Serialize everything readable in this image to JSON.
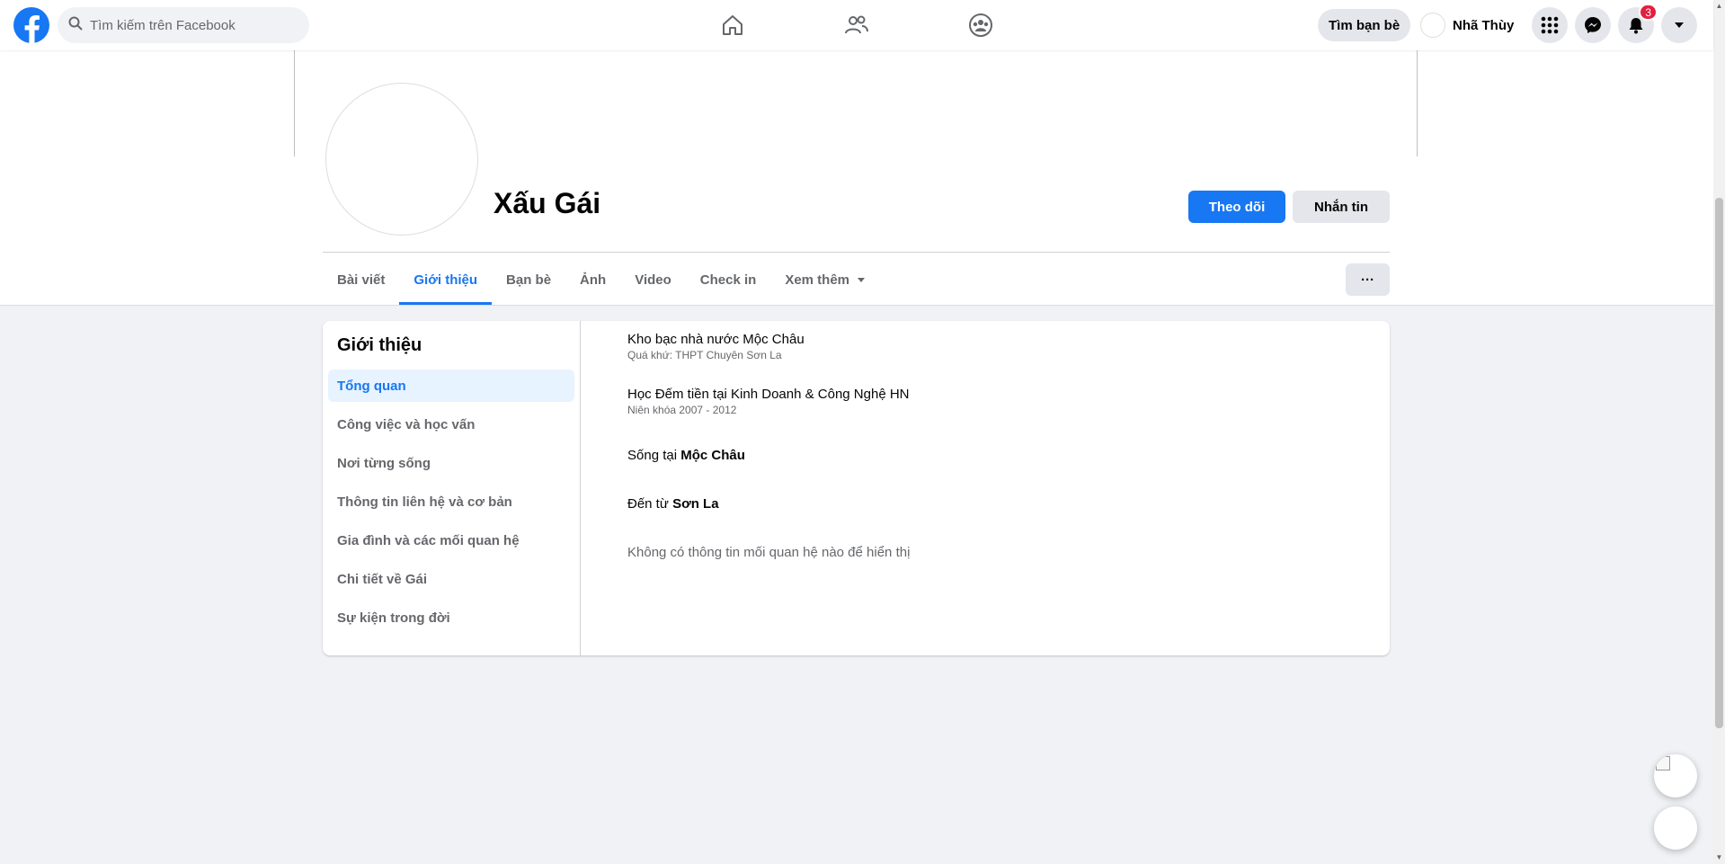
{
  "topbar": {
    "logo_icon": "facebook-logo",
    "search": {
      "placeholder": "Tìm kiếm trên Facebook",
      "value": ""
    },
    "nav_icons": [
      "home-icon",
      "friends-icon",
      "groups-icon"
    ],
    "find_friends_label": "Tìm bạn bè",
    "user_name": "Nhã Thùy",
    "notification_count": "3",
    "right_icons": [
      "menu-grid-icon",
      "messenger-icon",
      "bell-icon",
      "caret-down-icon"
    ]
  },
  "profile": {
    "name": "Xấu Gái",
    "follow_label": "Theo dõi",
    "message_label": "Nhắn tin",
    "more_label": "···"
  },
  "tabs": [
    {
      "label": "Bài viết",
      "active": false
    },
    {
      "label": "Giới thiệu",
      "active": true
    },
    {
      "label": "Bạn bè",
      "active": false
    },
    {
      "label": "Ảnh",
      "active": false
    },
    {
      "label": "Video",
      "active": false
    },
    {
      "label": "Check in",
      "active": false
    },
    {
      "label": "Xem thêm",
      "active": false
    }
  ],
  "about": {
    "title": "Giới thiệu",
    "nav": [
      {
        "label": "Tổng quan",
        "active": true
      },
      {
        "label": "Công việc và học vấn",
        "active": false
      },
      {
        "label": "Nơi từng sống",
        "active": false
      },
      {
        "label": "Thông tin liên hệ và cơ bản",
        "active": false
      },
      {
        "label": "Gia đình và các mối quan hệ",
        "active": false
      },
      {
        "label": "Chi tiết về Gái",
        "active": false
      },
      {
        "label": "Sự kiện trong đời",
        "active": false
      }
    ],
    "items": {
      "work": {
        "main": "Kho bạc nhà nước Mộc Châu",
        "sub": "Quá khứ: THPT Chuyên Sơn La"
      },
      "edu": {
        "main": "Học Đếm tiền tại Kinh Doanh & Công Nghệ HN",
        "sub": "Niên khóa 2007 - 2012"
      },
      "lives": {
        "prefix": "Sống tại ",
        "place": "Mộc Châu"
      },
      "from": {
        "prefix": "Đến từ ",
        "place": "Sơn La"
      },
      "relationship_empty": "Không có thông tin mối quan hệ nào để hiển thị"
    }
  },
  "colors": {
    "brand": "#1877f2",
    "active_nav_bg": "#e7f3ff",
    "badge": "#e41e3f"
  }
}
